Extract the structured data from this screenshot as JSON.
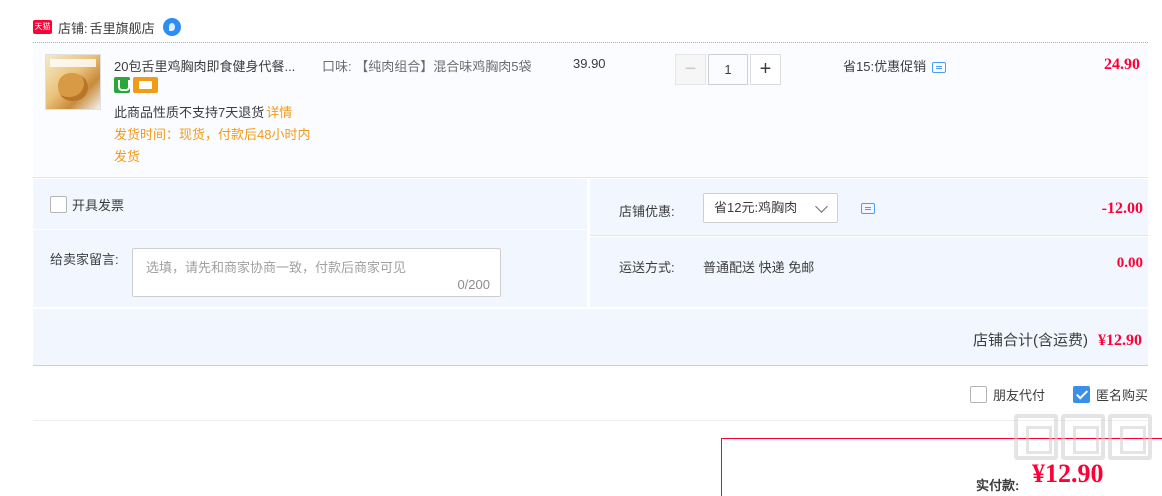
{
  "shop": {
    "badge": "天猫",
    "label": "店铺:",
    "name": "舌里旗舰店"
  },
  "item": {
    "title": "20包舌里鸡胸肉即食健身代餐...",
    "sku_label": "口味:",
    "sku_value": "【纯肉组合】混合味鸡胸肉5袋",
    "no_return_text": "此商品性质不支持7天退货",
    "detail_link": "详情",
    "ship_time": "发货时间：现货，付款后48小时内发货",
    "unit_price": "39.90",
    "quantity": "1",
    "minus": "−",
    "plus": "+",
    "promo": "省15:优惠促销",
    "subtotal": "24.90"
  },
  "invoice": {
    "label": "开具发票",
    "checked": false
  },
  "message": {
    "label": "给卖家留言:",
    "placeholder": "选填，请先和商家协商一致，付款后商家可见",
    "counter": "0/200"
  },
  "coupon": {
    "label": "店铺优惠:",
    "selected": "省12元:鸡胸肉",
    "amount": "-12.00"
  },
  "shipping": {
    "label": "运送方式:",
    "method": "普通配送 快递 免邮",
    "fee": "0.00"
  },
  "shop_total": {
    "label": "店铺合计(含运费)",
    "value": "¥12.90"
  },
  "extra": {
    "friend_pay_label": "朋友代付",
    "friend_pay_checked": false,
    "anonymous_label": "匿名购买",
    "anonymous_checked": true
  },
  "pay": {
    "label": "实付款:",
    "amount": "¥12.90"
  },
  "watermark": {
    "text": "什么值得买"
  },
  "colors": {
    "accent_red": "#ff0036",
    "light_blue_bg": "#f2f7ff",
    "link_orange": "#f29b18",
    "check_blue": "#3a8fea"
  }
}
